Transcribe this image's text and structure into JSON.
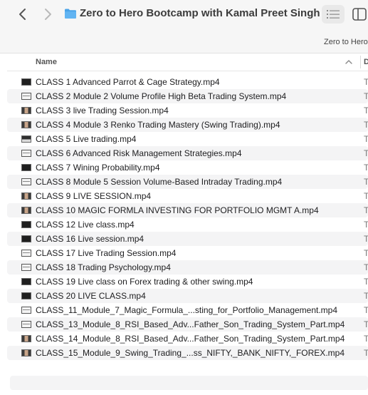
{
  "window": {
    "title": "Zero to Hero Bootcamp with Kamal Preet Singh",
    "path_fragment": "Zero to Hero"
  },
  "toolbar": {
    "back_icon": "chevron-left-icon",
    "forward_icon": "chevron-right-icon",
    "folder_icon": "folder-icon",
    "view_icon": "list-view-icon",
    "sidebar_icon": "sidebar-icon"
  },
  "columns": {
    "name": "Name",
    "date_abbrev": "D",
    "sort_icon": "chevron-up-icon"
  },
  "files": [
    {
      "name": "CLASS 1 Advanced Parrot & Cage Strategy.mp4",
      "thumb": "dark",
      "kind": "T"
    },
    {
      "name": "CLASS 2 Module 2 Volume Profile High Beta Trading System.mp4",
      "thumb": "light",
      "kind": "T"
    },
    {
      "name": "CLASS 3 live Trading Session.mp4",
      "thumb": "face",
      "kind": "T"
    },
    {
      "name": "CLASS 4 Module 3 Renko Trading Mastery (Swing Trading).mp4",
      "thumb": "face",
      "kind": "T"
    },
    {
      "name": "CLASS 5 Live trading.mp4",
      "thumb": "mixed",
      "kind": "T"
    },
    {
      "name": "CLASS 6 Advanced Risk Management Strategies.mp4",
      "thumb": "light",
      "kind": "T"
    },
    {
      "name": "CLASS 7 Wining Probability.mp4",
      "thumb": "dark",
      "kind": "T"
    },
    {
      "name": "CLASS 8 Module 5 Session Volume-Based Intraday Trading.mp4",
      "thumb": "light",
      "kind": "T"
    },
    {
      "name": "CLASS 9 LIVE SESSION.mp4",
      "thumb": "face",
      "kind": "T"
    },
    {
      "name": "CLASS 10 MAGIC FORMLA INVESTING FOR PORTFOLIO MGMT A.mp4",
      "thumb": "face",
      "kind": "T"
    },
    {
      "name": "CLASS 12 Live class.mp4",
      "thumb": "dark",
      "kind": "T"
    },
    {
      "name": "CLASS 16 Live session.mp4",
      "thumb": "dark",
      "kind": "T"
    },
    {
      "name": "CLASS 17 Live Trading Session.mp4",
      "thumb": "light",
      "kind": "T"
    },
    {
      "name": "CLASS 18 Trading Psychology.mp4",
      "thumb": "light",
      "kind": "T"
    },
    {
      "name": "CLASS 19 Live class on Forex trading & other swing.mp4",
      "thumb": "dark",
      "kind": "T"
    },
    {
      "name": "CLASS 20 LIVE CLASS.mp4",
      "thumb": "dark",
      "kind": "T"
    },
    {
      "name": "CLASS_11_Module_7_Magic_Formula_...sting_for_Portfolio_Management.mp4",
      "thumb": "light",
      "kind": "T"
    },
    {
      "name": "CLASS_13_Module_8_RSI_Based_Adv...Father_Son_Trading_System_Part.mp4",
      "thumb": "light",
      "kind": "T"
    },
    {
      "name": "CLASS_14_Module_8_RSI_Based_Adv...Father_Son_Trading_System_Part.mp4",
      "thumb": "face",
      "kind": "T"
    },
    {
      "name": "CLASS_15_Module_9_Swing_Trading_...ss_NIFTY,_BANK_NIFTY,_FOREX.mp4",
      "thumb": "face",
      "kind": "T"
    }
  ]
}
